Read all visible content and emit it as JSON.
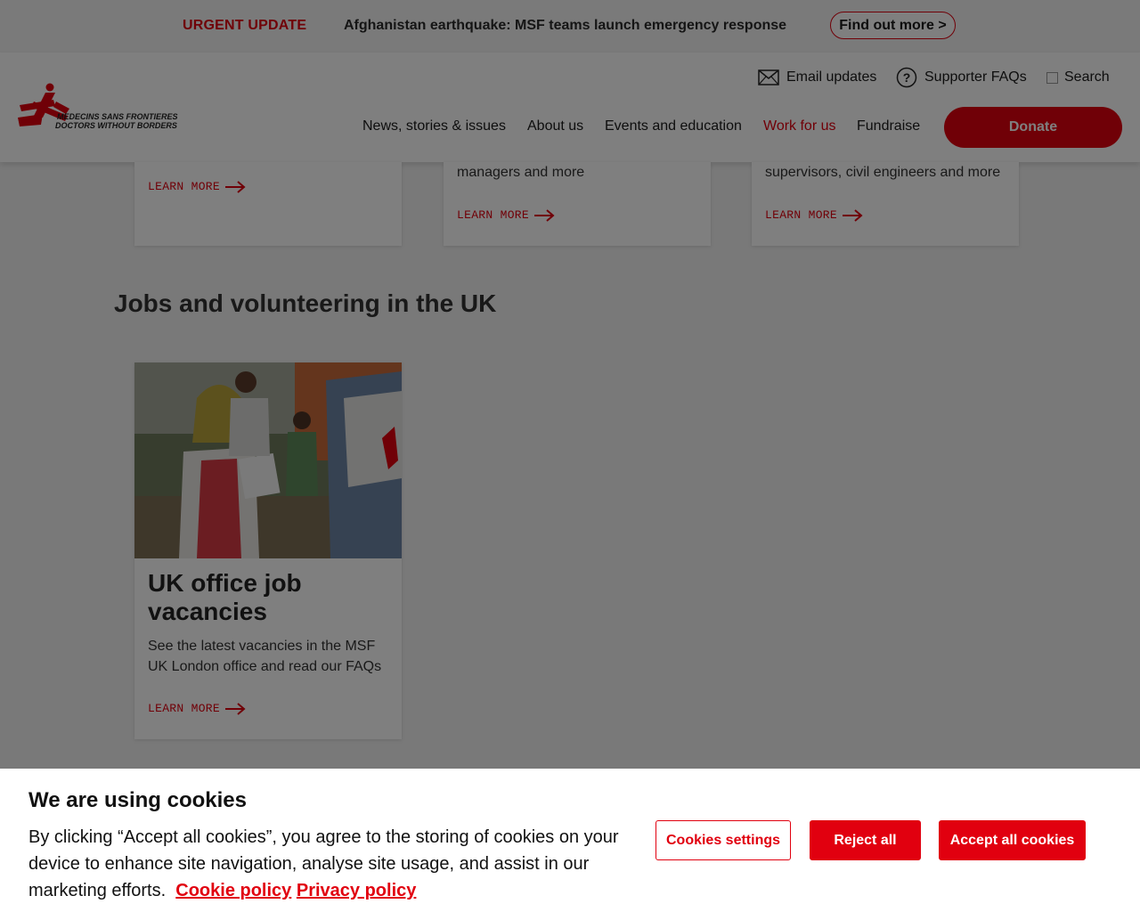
{
  "urgent_bar": {
    "tag": "URGENT UPDATE",
    "message": "Afghanistan earthquake: MSF teams launch emergency response",
    "button_label": "Find out more >"
  },
  "header": {
    "logo_line1": "MEDECINS SANS FRONTIERES",
    "logo_line2": "DOCTORS WITHOUT BORDERS",
    "utility": {
      "email_label": "Email updates",
      "faq_label": "Supporter FAQs",
      "search_label": "Search"
    },
    "nav": [
      {
        "label": "News, stories & issues"
      },
      {
        "label": "About us"
      },
      {
        "label": "Events and education"
      },
      {
        "label": "Work for us"
      },
      {
        "label": "Fundraise"
      }
    ],
    "donate_label": "Donate"
  },
  "top_cards": [
    {
      "description": "",
      "link": "LEARN MORE"
    },
    {
      "description": "managers and more",
      "link": "LEARN MORE"
    },
    {
      "description": "supervisors, civil engineers and more",
      "link": "LEARN MORE"
    }
  ],
  "uk_section": {
    "title": "Jobs and volunteering in the UK",
    "card": {
      "title": "UK office job vacancies",
      "description": "See the latest vacancies in the MSF UK London office and read our FAQs",
      "link": "LEARN MORE"
    }
  },
  "cookie_banner": {
    "title": "We are using cookies",
    "text": "By clicking “Accept all cookies”, you agree to the storing of cookies on your device to enhance site navigation, analyse site usage, and assist in our marketing efforts.",
    "cookie_policy_link": "Cookie policy",
    "privacy_policy_link": "Privacy policy",
    "settings_label": "Cookies settings",
    "reject_label": "Reject all",
    "accept_label": "Accept all cookies"
  },
  "colors": {
    "brand_red": "#e1000f",
    "overlay": "rgba(0,0,0,0.5)"
  },
  "icons": [
    "envelope-icon",
    "question-circle-icon",
    "search-checkbox-icon",
    "arrow-right-icon",
    "msf-logo-icon"
  ]
}
